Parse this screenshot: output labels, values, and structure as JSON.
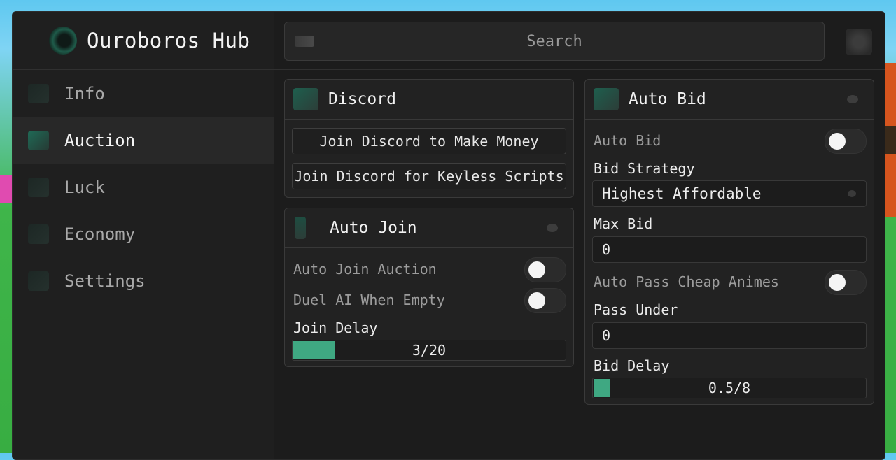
{
  "app": {
    "title": "Ouroboros Hub"
  },
  "search": {
    "placeholder": "Search"
  },
  "sidebar": {
    "items": [
      {
        "label": "Info"
      },
      {
        "label": "Auction"
      },
      {
        "label": "Luck"
      },
      {
        "label": "Economy"
      },
      {
        "label": "Settings"
      }
    ],
    "active": "Auction"
  },
  "discord": {
    "title": "Discord",
    "buttons": [
      "Join Discord to Make Money",
      "Join Discord for Keyless Scripts"
    ]
  },
  "auto_join": {
    "title": "Auto Join",
    "toggles": [
      {
        "label": "Auto Join Auction",
        "on": false
      },
      {
        "label": "Duel AI When Empty",
        "on": false
      }
    ],
    "delay_label": "Join Delay",
    "delay_value": "3/20",
    "delay_fraction": 0.15
  },
  "auto_bid": {
    "title": "Auto Bid",
    "toggle_label": "Auto Bid",
    "toggle_on": false,
    "strategy_label": "Bid Strategy",
    "strategy_value": "Highest Affordable",
    "max_bid_label": "Max Bid",
    "max_bid_value": "0",
    "pass_cheap_label": "Auto Pass Cheap Animes",
    "pass_cheap_on": false,
    "pass_under_label": "Pass Under",
    "pass_under_value": "0",
    "delay_label": "Bid Delay",
    "delay_value": "0.5/8",
    "delay_fraction": 0.0625
  },
  "colors": {
    "accent": "#3fa882",
    "panel": "#222222",
    "background": "#1c1c1c"
  }
}
